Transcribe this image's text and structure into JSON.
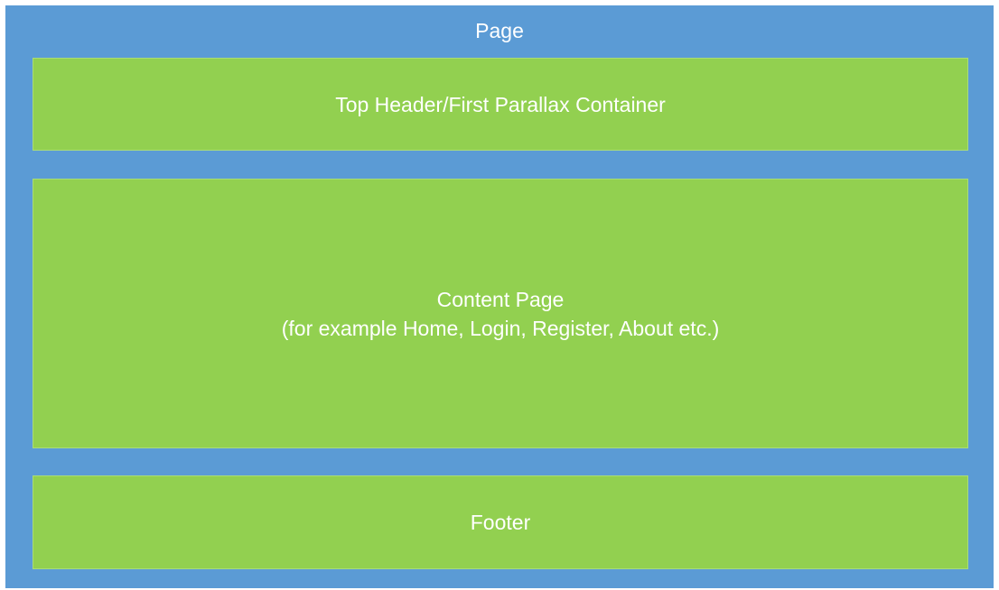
{
  "page": {
    "label": "Page"
  },
  "header_container": {
    "label": "Top Header/First Parallax Container"
  },
  "content_page": {
    "label_line1": "Content Page",
    "label_line2": "(for example Home, Login, Register, About etc.)"
  },
  "footer": {
    "label": "Footer"
  },
  "colors": {
    "page_background": "#5b9bd5",
    "section_background": "#92d050",
    "text": "#ffffff"
  }
}
